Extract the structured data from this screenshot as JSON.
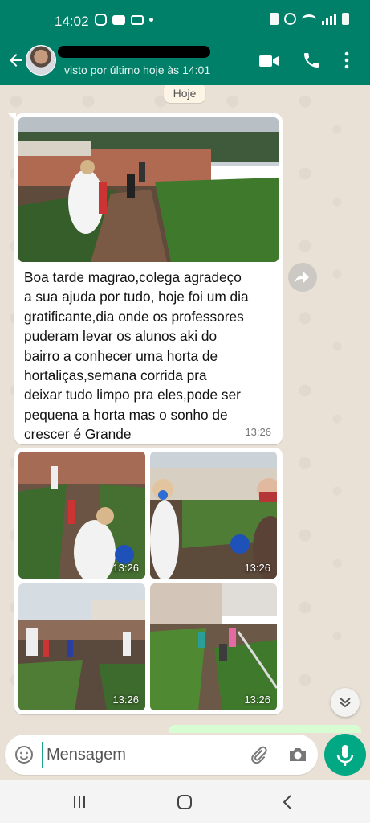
{
  "status_bar": {
    "time": "14:02"
  },
  "header": {
    "last_seen": "visto por último hoje às 14:01"
  },
  "chat": {
    "date_chip": "Hoje",
    "message1": {
      "caption": "Boa tarde magrao,colega agradeço\na sua ajuda por tudo, hoje foi um dia\ngratificante,dia onde os professores\npuderam levar os alunos aki do\nbairro a conhecer uma horta de\nhortaliças,semana corrida pra\ndeixar tudo limpo pra eles,pode ser\npequena a horta mas o sonho de\ncrescer é Grande",
      "time": "13:26"
    },
    "album": {
      "times": [
        "13:26",
        "13:26",
        "13:26",
        "13:26"
      ]
    }
  },
  "input": {
    "placeholder": "Mensagem"
  },
  "colors": {
    "brand": "#008069",
    "accent": "#00a884",
    "chat_bg": "#e9e1d6"
  }
}
